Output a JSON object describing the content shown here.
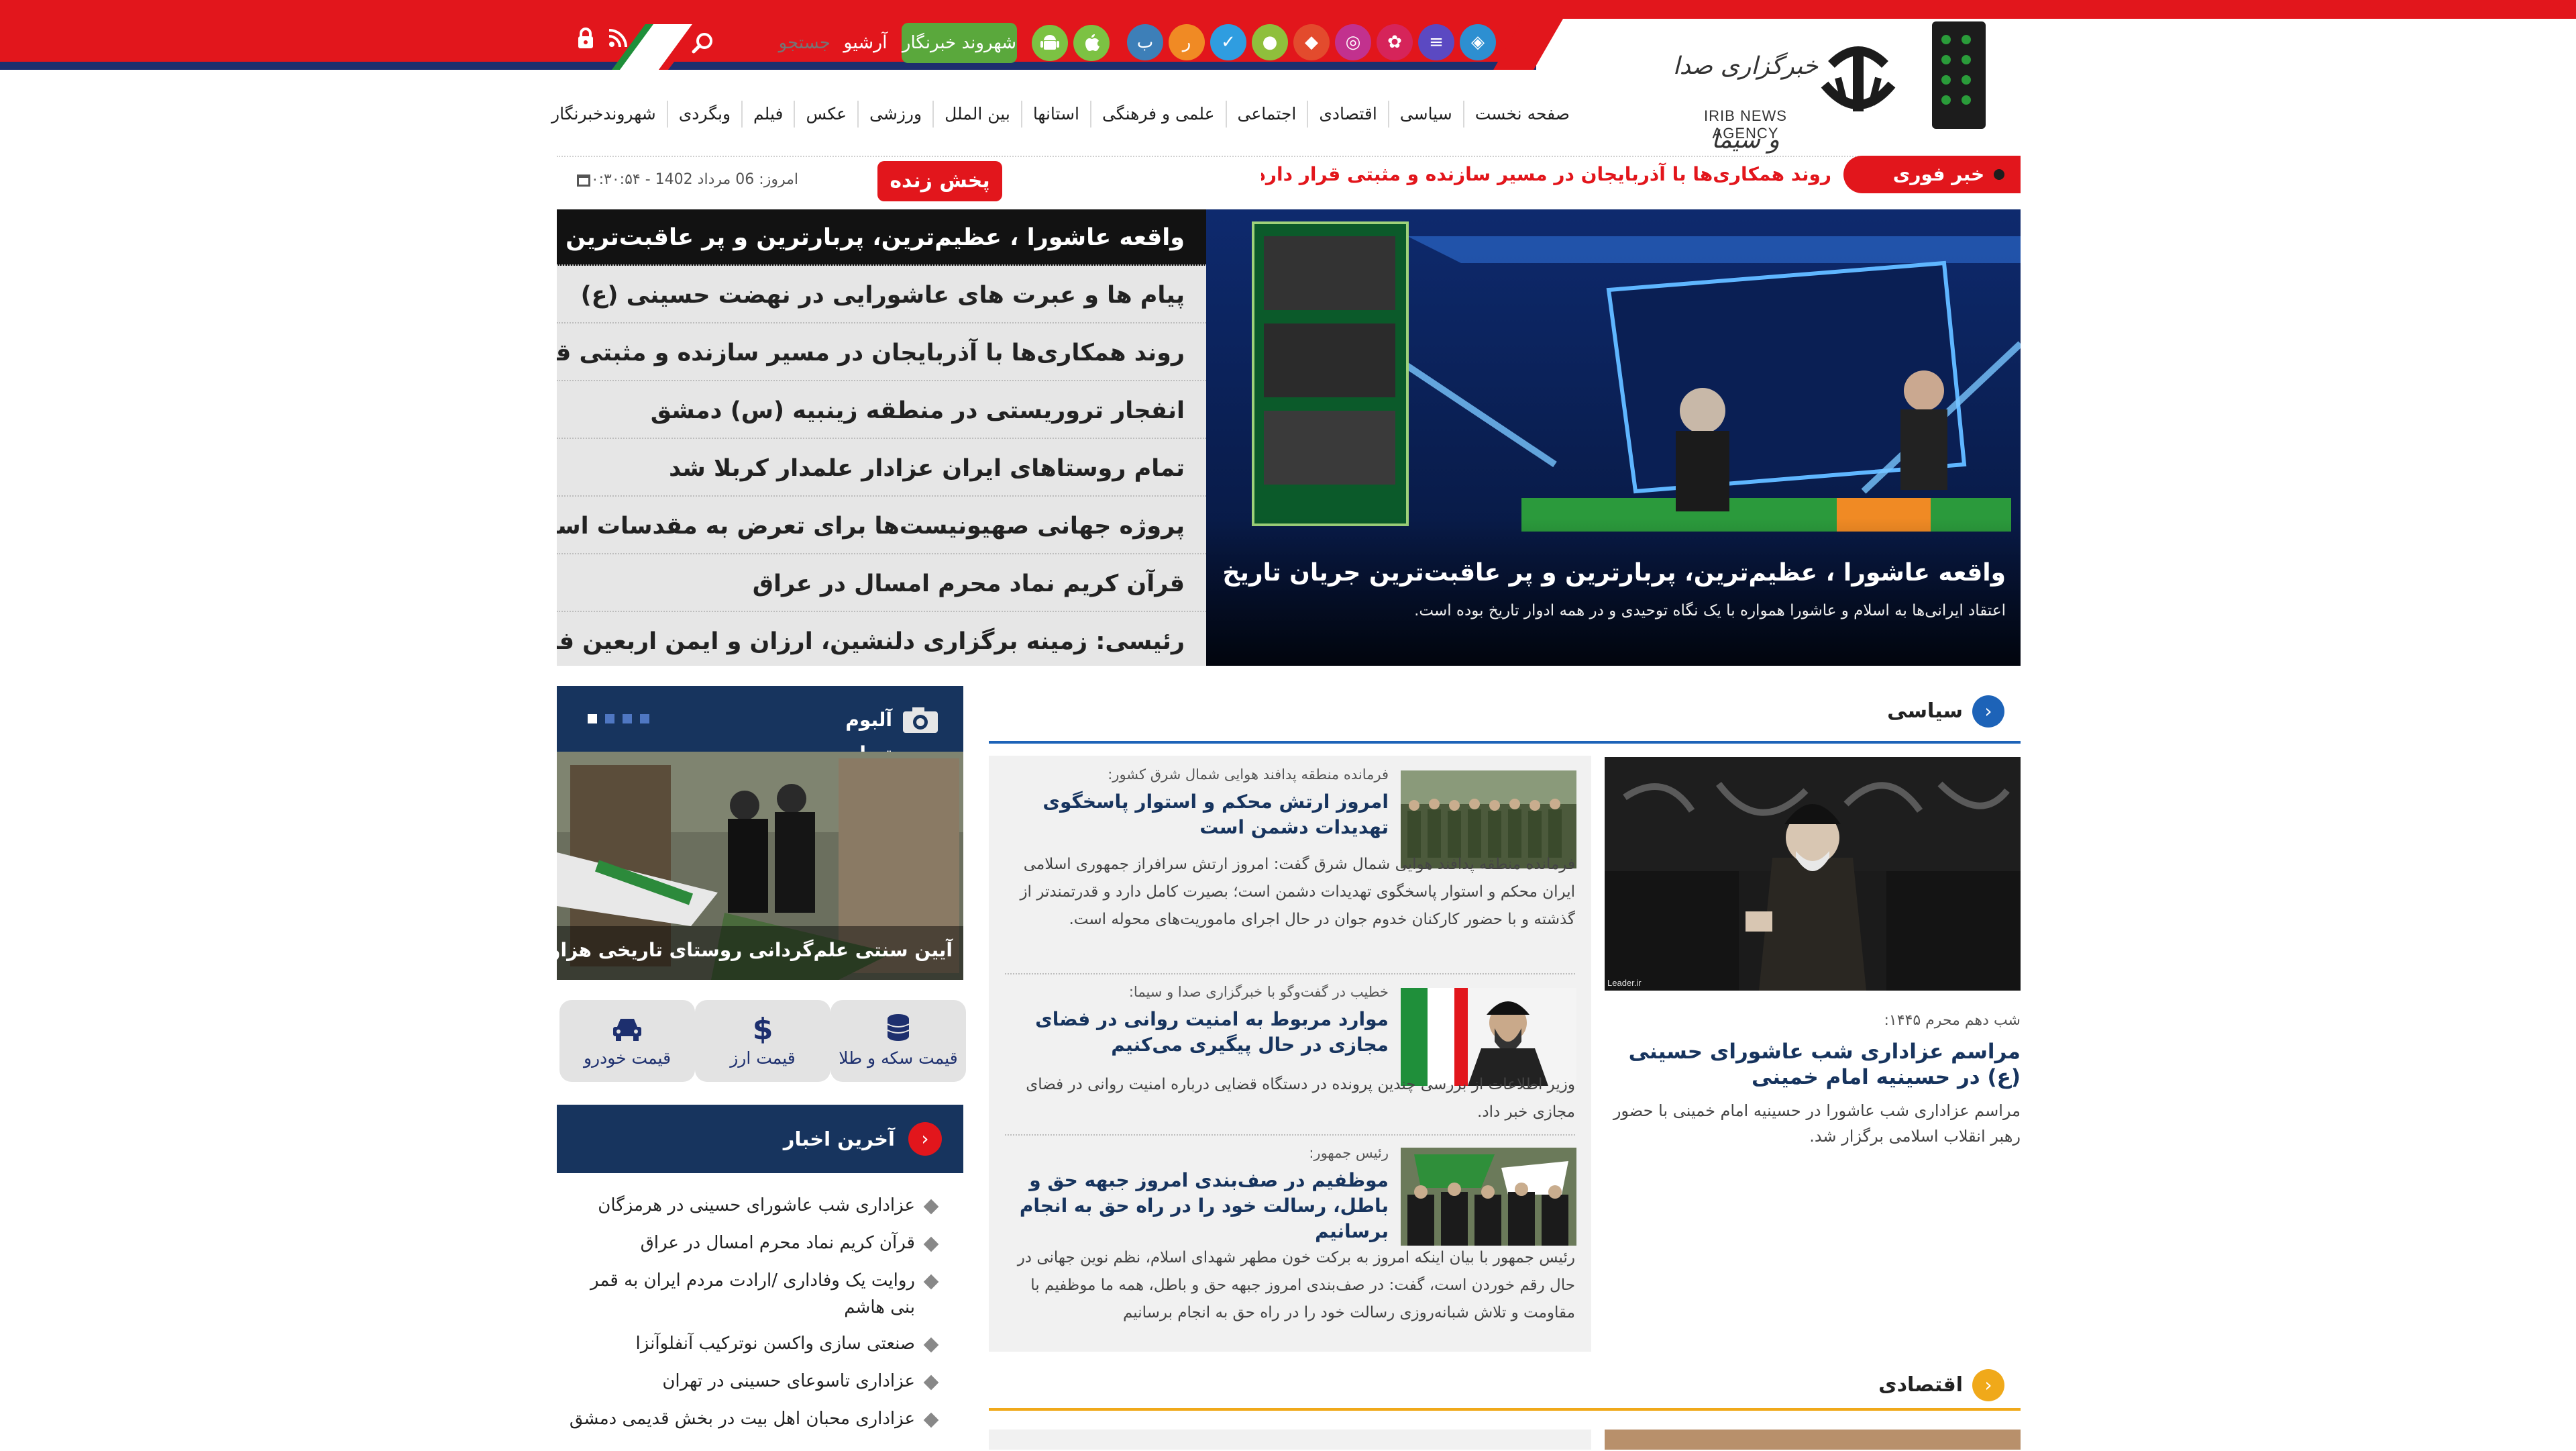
{
  "colors": {
    "brand_red": "#e2161c",
    "navy": "#17345e",
    "politics_blue": "#1d63b8",
    "economy_orange": "#f0a91a"
  },
  "header": {
    "search_placeholder": "جستجو",
    "archive_label": "آرشیو",
    "citizen_reporter_label": "شهروند خبرنگار",
    "social_icons": [
      "bale-icon",
      "rubika-icon",
      "eitaa-icon",
      "soroush-icon",
      "igap-icon",
      "gap-icon",
      "instagram-icon",
      "aparat-icon",
      "telegram-icon",
      "ble-icon"
    ],
    "store_icons": [
      "apple-icon",
      "android-icon"
    ],
    "rss_icon": "rss-icon",
    "lock_icon": "lock-icon"
  },
  "logo": {
    "name_fa": "خبرگزاری صدا و سیما",
    "name_en": "IRIB NEWS AGENCY"
  },
  "nav": {
    "items": [
      "صفحه نخست",
      "سیاسی",
      "اقتصادی",
      "اجتماعی",
      "علمی و فرهنگی",
      "استانها",
      "بین الملل",
      "ورزشی",
      "عکس",
      "فیلم",
      "وبگردی",
      "شهروندخبرنگار"
    ]
  },
  "breaking": {
    "label": "خبر فوری",
    "text": "روند همکاری‌ها با آذربایجان در مسیر سازنده و مثبتی قرار دارد"
  },
  "live": {
    "label": "پخش زنده"
  },
  "date": {
    "text": "امروز: 06 مرداد 1402 - ۲۰:۳۰:۵۴"
  },
  "hero": {
    "items": [
      "واقعه عاشورا ، عظیم‌ترین، پربارترین و پر عاقبت‌ترین جریان",
      "پیام ها و عبرت های عاشورایی در نهضت حسینی (ع)",
      "روند همکاری‌ها با آذربایجان در مسیر سازنده و مثبتی قرار دارد",
      "انفجار تروریستی در منطقه زینبیه (س) دمشق",
      "تمام روستاهای ایران عزادار علمدار کربلا شد",
      "پروژه جهانی صهیونیست‌ها برای تعرض به مقدسات اسلامی",
      "قرآن کریم نماد محرم امسال در عراق",
      "رئیسی: زمینه برگزاری دلنشین، ارزان و ایمن اربعین فراهم شود"
    ],
    "caption_title": "واقعه عاشورا ، عظیم‌ترین، پربارترین و پر عاقبت‌ترین جریان تاریخ",
    "caption_text": "اعتقاد ایرانی‌ها به اسلام و عاشورا همواره با یک نگاه توحیدی و در همه ادوار تاریخ بوده است."
  },
  "album": {
    "title": "آلبوم تصاویر",
    "caption": "آیین سنتی علم‌گردانی روستای تاریخی هزاوه اراک",
    "dots": 4,
    "active_dot": 4
  },
  "prices": {
    "items": [
      {
        "label": "قیمت سکه و طلا",
        "icon": "coins-icon"
      },
      {
        "label": "قیمت ارز",
        "icon": "dollar-icon"
      },
      {
        "label": "قیمت خودرو",
        "icon": "car-icon"
      }
    ]
  },
  "latest": {
    "title": "آخرین اخبار",
    "items": [
      "عزاداری شب عاشورای حسینی در هرمزگان",
      "قرآن کریم نماد محرم امسال در عراق",
      "روایت یک وفاداری /ارادت مردم ایران به قمر بنی هاشم",
      "صنعتی سازی واکسن نوترکیب آنفلوآنزا",
      "عزاداری تاسوعای حسینی در تهران",
      "عزاداری محبان اهل بیت در بخش قدیمی دمشق"
    ]
  },
  "politics": {
    "title": "سیاسی",
    "main": {
      "kicker": "شب دهم محرم ۱۴۴۵:",
      "title": "مراسم عزاداری شب عاشورای حسینی (ع) در حسینیه امام خمینی",
      "text": "مراسم عزاداری شب عاشورا در حسینیه امام خمینی با حضور رهبر انقلاب اسلامی برگزار شد.",
      "image_credit": "Leader.ir"
    },
    "side": [
      {
        "kicker": "فرمانده منطقه پدافند هوایی شمال شرق کشور:",
        "title": "امروز ارتش محکم و استوار پاسخگوی تهدیدات دشمن است",
        "text": "فرمانده منطقه پدافند هوایی شمال شرق گفت: امروز ارتش سرافراز جمهوری اسلامی ایران محکم و استوار پاسخگوی تهدیدات دشمن است؛ بصیرت کامل دارد و قدرتمندتر از گذشته و با حضور کارکنان خدوم جوان در حال اجرای ماموریت‌های محوله است."
      },
      {
        "kicker": "خطیب در گفت‌وگو با خبرگزاری صدا و سیما:",
        "title": "موارد مربوط به امنیت روانی در فضای مجازی در حال پیگیری می‌کنیم",
        "text": "وزیر اطلاعات از بررسی چندین پرونده در دستگاه قضایی درباره امنیت روانی در فضای مجازی خبر داد."
      },
      {
        "kicker": "رئیس جمهور:",
        "title": "موظفیم در صف‌بندی امروز جبهه حق و باطل، رسالت خود را در راه حق به انجام برسانیم",
        "text": "رئیس جمهور با بیان اینکه امروز به برکت خون مطهر شهدای اسلام، نظم نوین جهانی در حال رقم خوردن است، گفت: در صف‌بندی امروز جبهه حق و باطل، همه ما موظفیم با مقاومت و تلاش شبانه‌روزی رسالت خود را در راه حق به انجام برسانیم"
      }
    ]
  },
  "economy": {
    "title": "اقتصادی"
  }
}
